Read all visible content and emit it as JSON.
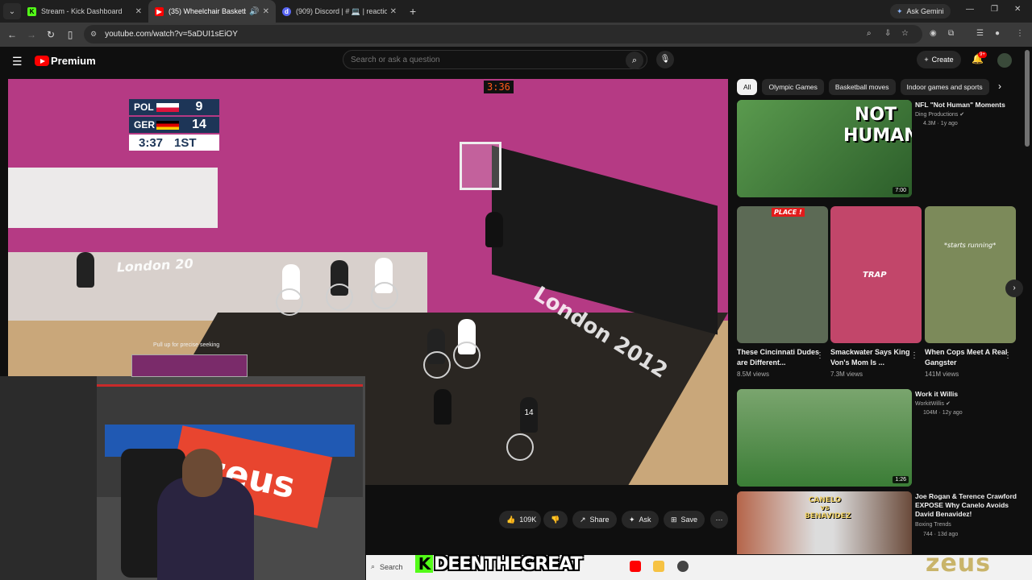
{
  "browser": {
    "tabs": [
      {
        "title": "Stream - Kick Dashboard",
        "active": false,
        "favicon": "kick-icon",
        "color": "#53fc18"
      },
      {
        "title": "(35) Wheelchair Basketball",
        "active": true,
        "favicon": "youtube-icon",
        "color": "#ff0000"
      },
      {
        "title": "(909) Discord | # 💻 | reactions",
        "active": false,
        "favicon": "discord-icon",
        "color": "#5865f2"
      }
    ],
    "ask_gemini": "Ask Gemini",
    "url": "youtube.com/watch?v=5aDUI1sEiOY"
  },
  "youtube": {
    "brand": "Premium",
    "search_placeholder": "Search or ask a question",
    "create_label": "Create",
    "notification_badge": "9+"
  },
  "video": {
    "scoreboard": {
      "team1": "POL",
      "score1": "9",
      "team2": "GER",
      "score2": "14",
      "clock": "3:37",
      "period": "1ST"
    },
    "shot_clock": "3:36",
    "banner_text": "London 20",
    "court_text": "London 2012",
    "seek_hint": "Pull up for precise seeking",
    "jersey_number": "14",
    "progress": 0.27
  },
  "actions": {
    "like_count": "109K",
    "share": "Share",
    "ask": "Ask",
    "save": "Save"
  },
  "overlay": {
    "streamer_k": "K",
    "streamer_name": "DEENTHEGREAT",
    "taskbar_search": "Search",
    "sponsor_logo": "zeus",
    "banner_text": "zeus"
  },
  "sidebar": {
    "chips": [
      "All",
      "Olympic Games",
      "Basketball moves",
      "Indoor games and sports"
    ],
    "videos": [
      {
        "title": "NFL \"Not Human\" Moments",
        "channel": "Ding Productions",
        "verified": true,
        "views": "4.3M",
        "age": "1y ago",
        "duration": "7:00",
        "thumb_text": "NOT HUMAN"
      },
      {
        "title": "Work it Willis",
        "channel": "WorkitWillis",
        "verified": true,
        "views": "104M",
        "age": "12y ago",
        "duration": "1:26"
      },
      {
        "title": "Joe Rogan & Terence Crawford EXPOSE Why Canelo Avoids David Benavidez!",
        "channel": "Boxing Trends",
        "verified": false,
        "views": "744",
        "age": "13d ago",
        "thumb_text": "CANELO vs BENAVIDEZ"
      }
    ],
    "shorts": [
      {
        "title": "These Cincinnati Dudes are Different...",
        "views": "8.5M views",
        "badge": "PLACE !"
      },
      {
        "title": "Smackwater Says King Von's Mom Is ...",
        "views": "7.3M views",
        "badge": "TRAP"
      },
      {
        "title": "When Cops Meet A Real Gangster",
        "views": "141M views",
        "caption": "*starts running*"
      }
    ]
  }
}
